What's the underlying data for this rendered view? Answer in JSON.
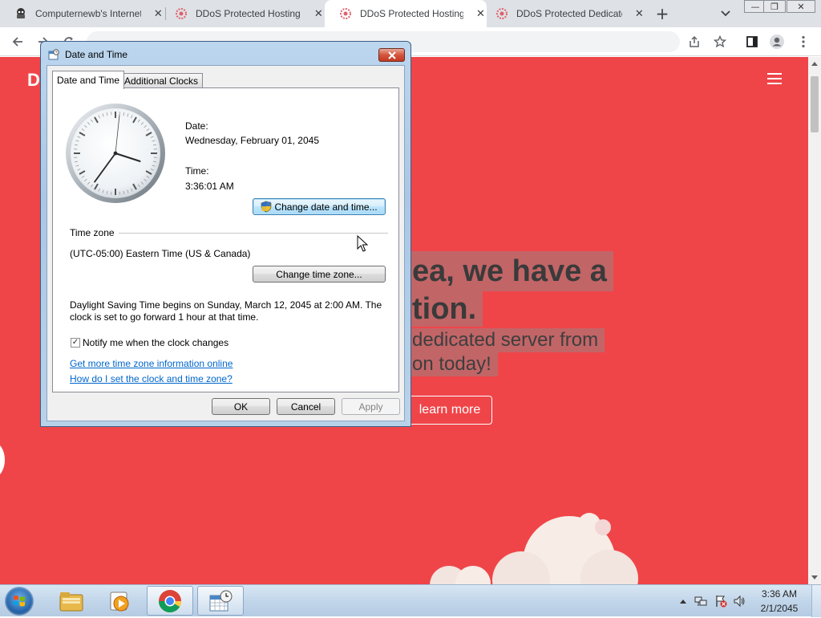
{
  "browser": {
    "tabs": [
      {
        "title": "Computernewb's Internet",
        "icon": "computernewb-favicon-icon",
        "active": false
      },
      {
        "title": "DDoS Protected Hosting",
        "icon": "ddos-favicon-icon",
        "active": false
      },
      {
        "title": "DDoS Protected Hosting",
        "icon": "ddos-favicon-icon",
        "active": true
      },
      {
        "title": "DDoS Protected Dedicate",
        "icon": "ddos-favicon-icon",
        "active": false
      }
    ],
    "address": "",
    "icons": [
      "back-icon",
      "forward-icon",
      "reload-icon",
      "share-icon",
      "bookmark-star-icon",
      "side-panel-icon",
      "profile-icon",
      "menu-icon"
    ]
  },
  "webpage": {
    "brand": "D",
    "headline_line1": "ea, we have a",
    "headline_line2": "tion.",
    "sub_line1": "dedicated server from",
    "sub_line2": "on today!",
    "cta": "learn more",
    "accent_color": "#ef4549"
  },
  "dialog": {
    "title": "Date and Time",
    "tabs": [
      "Date and Time",
      "Additional Clocks"
    ],
    "date_label": "Date:",
    "date_value": "Wednesday, February 01, 2045",
    "time_label": "Time:",
    "time_value": "3:36:01 AM",
    "change_datetime_button": "Change date and time...",
    "timezone_heading": "Time zone",
    "timezone_value": "(UTC-05:00) Eastern Time (US & Canada)",
    "change_timezone_button": "Change time zone...",
    "dst_line1": "Daylight Saving Time begins on Sunday, March 12, 2045 at 2:00 AM. The",
    "dst_line2": "clock is set to go forward 1 hour at that time.",
    "notify_label": "Notify me when the clock changes",
    "notify_checked": true,
    "link_more_info": "Get more time zone information online",
    "link_how_to": "How do I set the clock and time zone?",
    "ok": "OK",
    "cancel": "Cancel",
    "apply": "Apply",
    "clock_hour": 3,
    "clock_minute": 36,
    "clock_second": 1
  },
  "taskbar": {
    "pinned": [
      "explorer-folder-icon",
      "media-player-icon",
      "chrome-icon",
      "date-time-control-panel-icon"
    ],
    "tray_icons": [
      "show-hidden-icons-chevron",
      "network-icon",
      "action-center-flag-icon",
      "volume-icon"
    ],
    "time": "3:36 AM",
    "date": "2/1/2045"
  }
}
